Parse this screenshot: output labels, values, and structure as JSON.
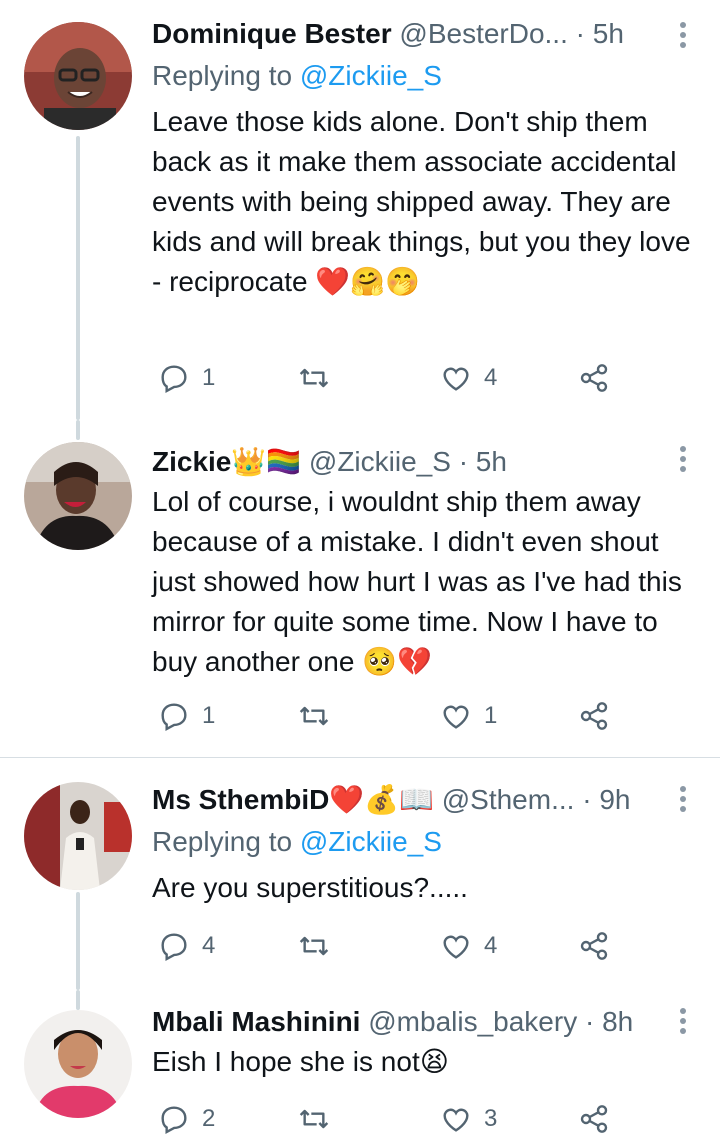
{
  "tweets": [
    {
      "name": "Dominique Bester",
      "handle": "@BesterDo...",
      "time": "5h",
      "replying_label": "Replying to",
      "replying_to": "@Zickiie_S",
      "text": "Leave those kids alone. Don't ship them back as it make them associate accidental events with being shipped away. They are kids and will break things, but you they love - reciprocate ❤️🤗🤭",
      "replies": "1",
      "retweets": "",
      "likes": "4"
    },
    {
      "name": "Zickie👑🏳️‍🌈",
      "handle": "@Zickiie_S",
      "time": "5h",
      "text": "Lol of course, i wouldnt ship them away because of a mistake. I didn't even shout just showed how hurt I was as I've had this mirror for quite some time. Now I have to buy another one 🥺💔",
      "replies": "1",
      "retweets": "",
      "likes": "1"
    },
    {
      "name": "Ms SthembiD❤️💰📖",
      "handle": "@Sthem...",
      "time": "9h",
      "replying_label": "Replying to",
      "replying_to": "@Zickiie_S",
      "text": "Are you superstitious?.....",
      "replies": "4",
      "retweets": "",
      "likes": "4"
    },
    {
      "name": "Mbali Mashinini",
      "handle": "@mbalis_bakery",
      "time": "8h",
      "text": "Eish I hope she is not😫",
      "replies": "2",
      "retweets": "",
      "likes": "3"
    }
  ],
  "separator": "·",
  "icons": [
    "reply-icon",
    "retweet-icon",
    "like-icon",
    "share-icon",
    "more-icon"
  ],
  "colors": {
    "link": "#1d9bf0",
    "secondary": "#536471",
    "thread_line": "#cfd9de"
  }
}
